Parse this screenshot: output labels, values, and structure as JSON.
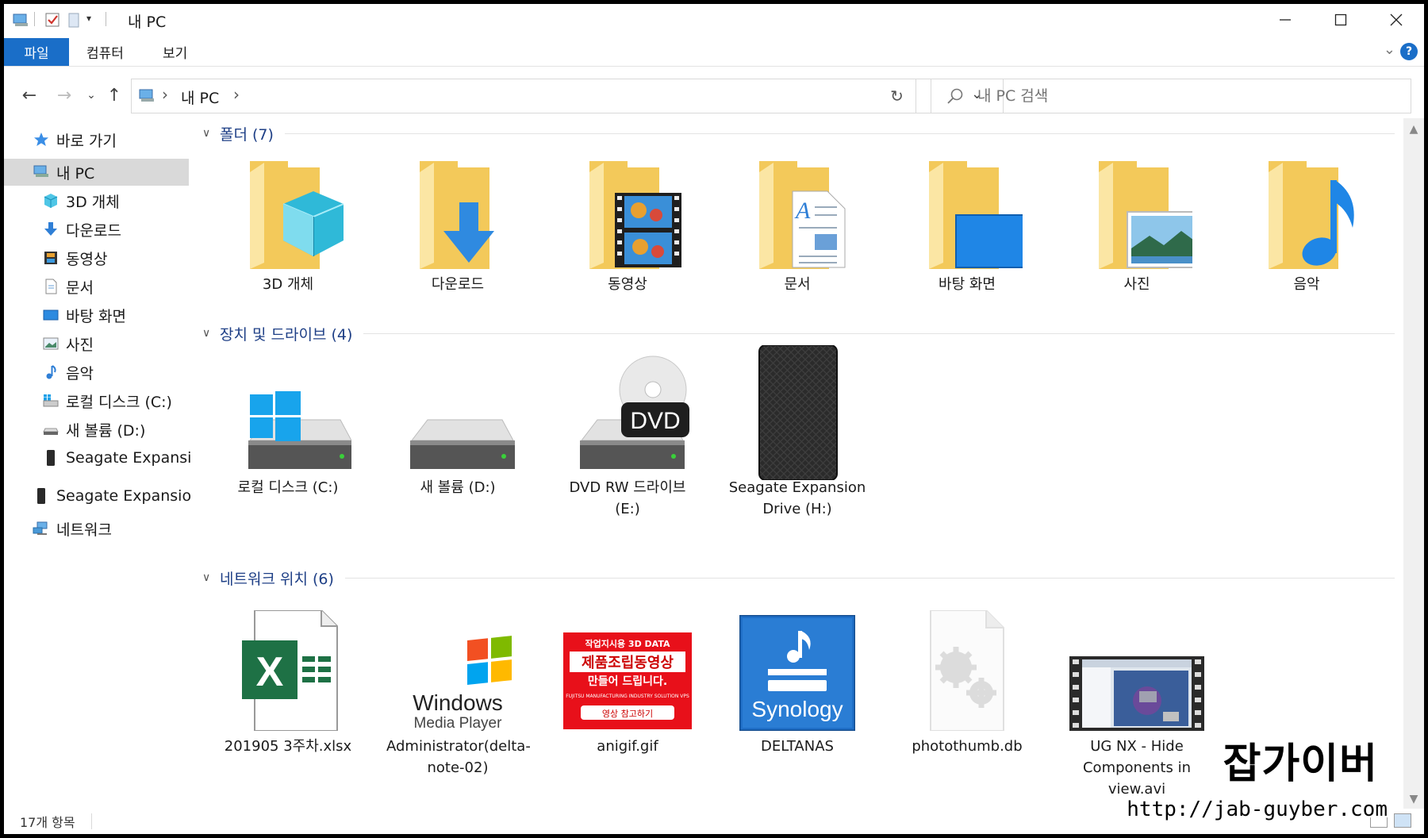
{
  "window": {
    "title": "내 PC",
    "ribbon_tabs": {
      "file": "파일",
      "computer": "컴퓨터",
      "view": "보기"
    },
    "help": "?"
  },
  "address": {
    "crumb": "내 PC",
    "separator": "›"
  },
  "search": {
    "placeholder": "내 PC 검색"
  },
  "nav": [
    {
      "label": "바로 가기",
      "icon": "star-icon"
    },
    {
      "label": "내 PC",
      "icon": "pc-icon",
      "selected": true
    },
    {
      "label": "3D 개체",
      "icon": "cube-icon"
    },
    {
      "label": "다운로드",
      "icon": "download-icon"
    },
    {
      "label": "동영상",
      "icon": "video-icon"
    },
    {
      "label": "문서",
      "icon": "document-icon"
    },
    {
      "label": "바탕 화면",
      "icon": "desktop-icon"
    },
    {
      "label": "사진",
      "icon": "picture-icon"
    },
    {
      "label": "음악",
      "icon": "music-icon"
    },
    {
      "label": "로컬 디스크 (C:)",
      "icon": "windows-drive-icon"
    },
    {
      "label": "새 볼륨 (D:)",
      "icon": "drive-icon"
    },
    {
      "label": "Seagate Expansion Drive (H:)",
      "icon": "external-drive-icon"
    },
    {
      "label": "Seagate Expansion Drive (H:)",
      "icon": "external-drive-icon"
    },
    {
      "label": "네트워크",
      "icon": "network-icon"
    }
  ],
  "groups": {
    "folders": {
      "label": "폴더 (7)"
    },
    "drives": {
      "label": "장치 및 드라이브 (4)"
    },
    "network": {
      "label": "네트워크 위치 (6)"
    }
  },
  "folders": [
    {
      "label": "3D 개체",
      "icon": "3d-objects-folder-icon"
    },
    {
      "label": "다운로드",
      "icon": "downloads-folder-icon"
    },
    {
      "label": "동영상",
      "icon": "videos-folder-icon"
    },
    {
      "label": "문서",
      "icon": "documents-folder-icon"
    },
    {
      "label": "바탕 화면",
      "icon": "desktop-folder-icon"
    },
    {
      "label": "사진",
      "icon": "pictures-folder-icon"
    },
    {
      "label": "음악",
      "icon": "music-folder-icon"
    }
  ],
  "drives": [
    {
      "label": "로컬 디스크 (C:)",
      "icon": "windows-drive-icon"
    },
    {
      "label": "새 볼륨 (D:)",
      "icon": "drive-icon"
    },
    {
      "label": "DVD RW 드라이브 (E:)",
      "icon": "dvd-drive-icon",
      "badge": "DVD"
    },
    {
      "label": "Seagate Expansion Drive (H:)",
      "icon": "external-drive-icon"
    }
  ],
  "network": [
    {
      "label": "201905 3주차.xlsx",
      "icon": "excel-file-icon",
      "glyph": "X"
    },
    {
      "label": "Administrator(delta-note-02)",
      "icon": "windows-media-player-icon",
      "line1": "Windows",
      "line2": "Media Player"
    },
    {
      "label": "anigif.gif",
      "icon": "gif-image-icon",
      "t1": "작업지시용 3D DATA",
      "t2": "제품조립동영상",
      "t3": "만들어 드립니다.",
      "t4": "FUJITSU MANUFACTURING INDUSTRY SOLUTION VPS",
      "t5": "영상 참고하기"
    },
    {
      "label": "DELTANAS",
      "icon": "synology-nas-icon",
      "brand": "Synology"
    },
    {
      "label": "photothumb.db",
      "icon": "system-file-icon"
    },
    {
      "label": "UG NX - Hide Components in view.avi",
      "icon": "video-file-icon"
    }
  ],
  "status": {
    "count": "17개 항목"
  },
  "watermark": {
    "logo": "잡가이버",
    "url": "http://jab-guyber.com"
  },
  "colors": {
    "accent": "#1a6ec8",
    "group_label": "#1e3f86",
    "folder": "#f6d57a",
    "selected": "#d9d9d9"
  }
}
